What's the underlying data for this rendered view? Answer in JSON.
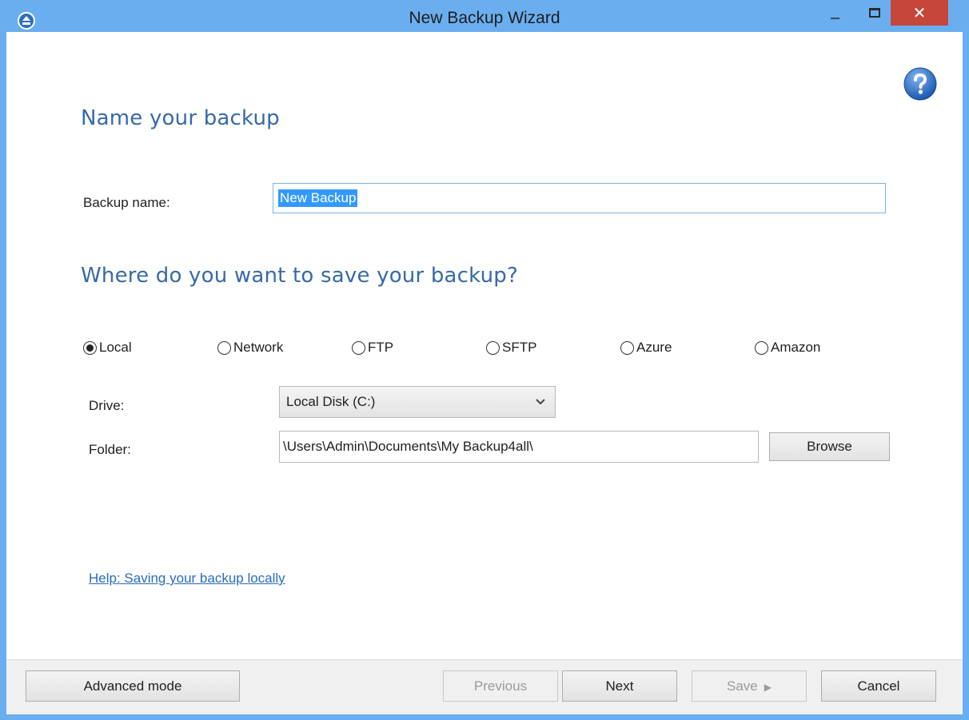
{
  "window": {
    "title": "New Backup Wizard",
    "close_glyph": "✕"
  },
  "page": {
    "heading_name": "Name your backup",
    "backup_name_label": "Backup name:",
    "backup_name_value": "New Backup",
    "heading_where": "Where do you want to save your backup?",
    "destinations": [
      {
        "label": "Local",
        "selected": true
      },
      {
        "label": "Network",
        "selected": false
      },
      {
        "label": "FTP",
        "selected": false
      },
      {
        "label": "SFTP",
        "selected": false
      },
      {
        "label": "Azure",
        "selected": false
      },
      {
        "label": "Amazon",
        "selected": false
      }
    ],
    "drive_label": "Drive:",
    "drive_value": "Local Disk (C:)",
    "folder_label": "Folder:",
    "folder_value": "\\Users\\Admin\\Documents\\My Backup4all\\",
    "browse_label": "Browse",
    "help_link": "Help: Saving your backup locally"
  },
  "footer": {
    "advanced_mode": "Advanced mode",
    "previous": "Previous",
    "next": "Next",
    "save": "Save",
    "cancel": "Cancel"
  },
  "icons": {
    "app": "eject-icon",
    "help": "question-icon",
    "dropdown": "chevron-down-icon",
    "save_arrow": "play-triangle-icon"
  },
  "colors": {
    "titlebar": "#6aaef0",
    "heading": "#3769a8",
    "close": "#c7463a",
    "selection": "#3399ff",
    "link": "#2a6bbf"
  }
}
